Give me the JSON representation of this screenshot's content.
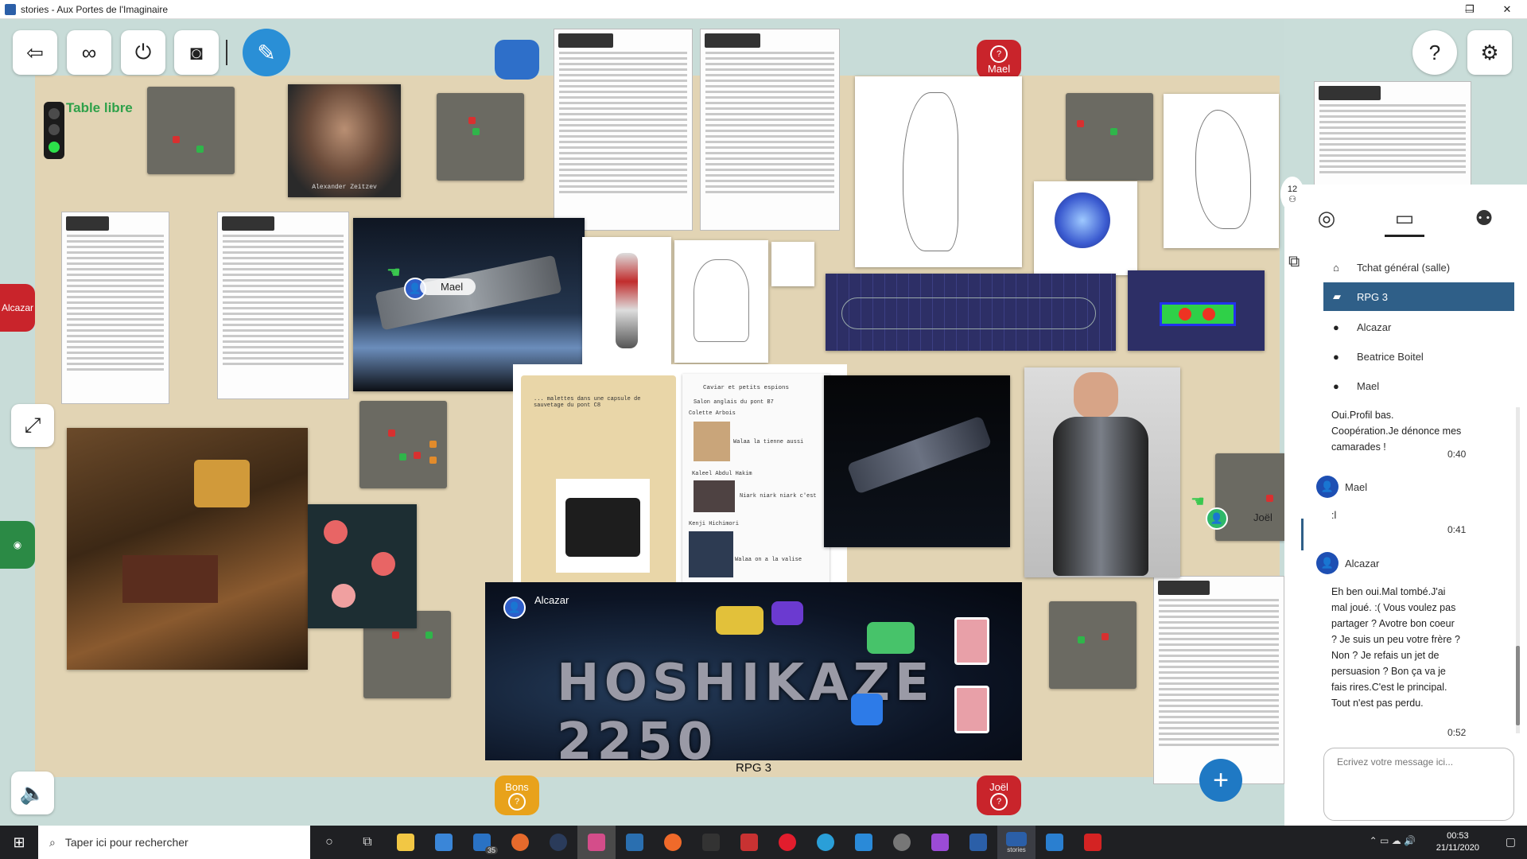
{
  "window": {
    "title": "stories - Aux Portes de l'Imaginaire",
    "minimize": "─",
    "maximize": "❐",
    "close": "✕"
  },
  "toolbar": {
    "leave_icon": "exit-icon",
    "link_icon": "link-icon",
    "power_icon": "power-icon",
    "camera_icon": "camera-icon",
    "mic_icon": "microphone-muted-icon",
    "help_icon": "help-icon",
    "settings_icon": "gear-icon"
  },
  "table": {
    "status_label": "Table libre",
    "name": "RPG 3",
    "banner_title": "HOSHIKAZE 2250"
  },
  "seats": {
    "top_blue": "",
    "mael": "Mael",
    "bons": "Bons",
    "joel": "Joël",
    "left_alcazar": "Alcazar",
    "left_green": ""
  },
  "on_table": {
    "portrait_caption": "Alexander Zeitzev",
    "mael_pill": "Mael",
    "joel_pill": "Joël",
    "alcazar_pill": "Alcazar",
    "folder_left_text": "... malettes dans une capsule de sauvetage du pont C8",
    "folder_title": "Caviar et petits espions",
    "folder_sub": "Salon anglais du pont B7",
    "p1_name": "Colette Arbois",
    "p1_note": "Walaa la tienne aussi",
    "p2_name": "Kaleel Abdul Hakim",
    "p2_note": "Niark niark niark c'est",
    "p3_name": "Kenji Hichimori",
    "p3_note": "Walaa on a la valise"
  },
  "panel": {
    "participants_count": "12",
    "tabs": [
      "profile-tab",
      "chat-tab",
      "users-tab"
    ],
    "channels": [
      {
        "label": "Tchat général (salle)",
        "icon": "home-icon",
        "active": false
      },
      {
        "label": "RPG 3",
        "icon": "table-icon",
        "active": true
      },
      {
        "label": "Alcazar",
        "icon": "user-icon",
        "active": false
      },
      {
        "label": "Beatrice Boitel",
        "icon": "user-icon",
        "active": false
      },
      {
        "label": "Mael",
        "icon": "user-icon",
        "active": false
      }
    ],
    "messages": [
      {
        "author": "",
        "text": "Oui.Profil bas. Coopération.Je dénonce mes camarades !",
        "time": "0:40"
      },
      {
        "author": "Mael",
        "text": ":l",
        "time": "0:41"
      },
      {
        "author": "Alcazar",
        "text": "Eh ben oui.Mal tombé.J'ai mal joué. :( Vous voulez pas partager ? Avotre bon coeur ? Je suis un peu votre frère ? Non ? Je refais un jet de persuasion ? Bon ça va je fais rires.C'est le principal. Tout n'est pas perdu.",
        "time": "0:52"
      }
    ],
    "input_placeholder": "Ecrivez votre message ici..."
  },
  "taskbar": {
    "search_placeholder": "Taper ici pour rechercher",
    "mail_badge": "35",
    "time": "00:53",
    "date": "21/11/2020",
    "stories_label": "stories"
  },
  "colors": {
    "accent": "#2f5f88",
    "mic": "#2a8fd6",
    "seat_red": "#c9242b",
    "seat_blue": "#2e6fc9",
    "seat_yellow": "#e8a21b",
    "seat_green": "#2b8a45",
    "table": "#e2d4b4",
    "room": "#c8dcd8"
  }
}
